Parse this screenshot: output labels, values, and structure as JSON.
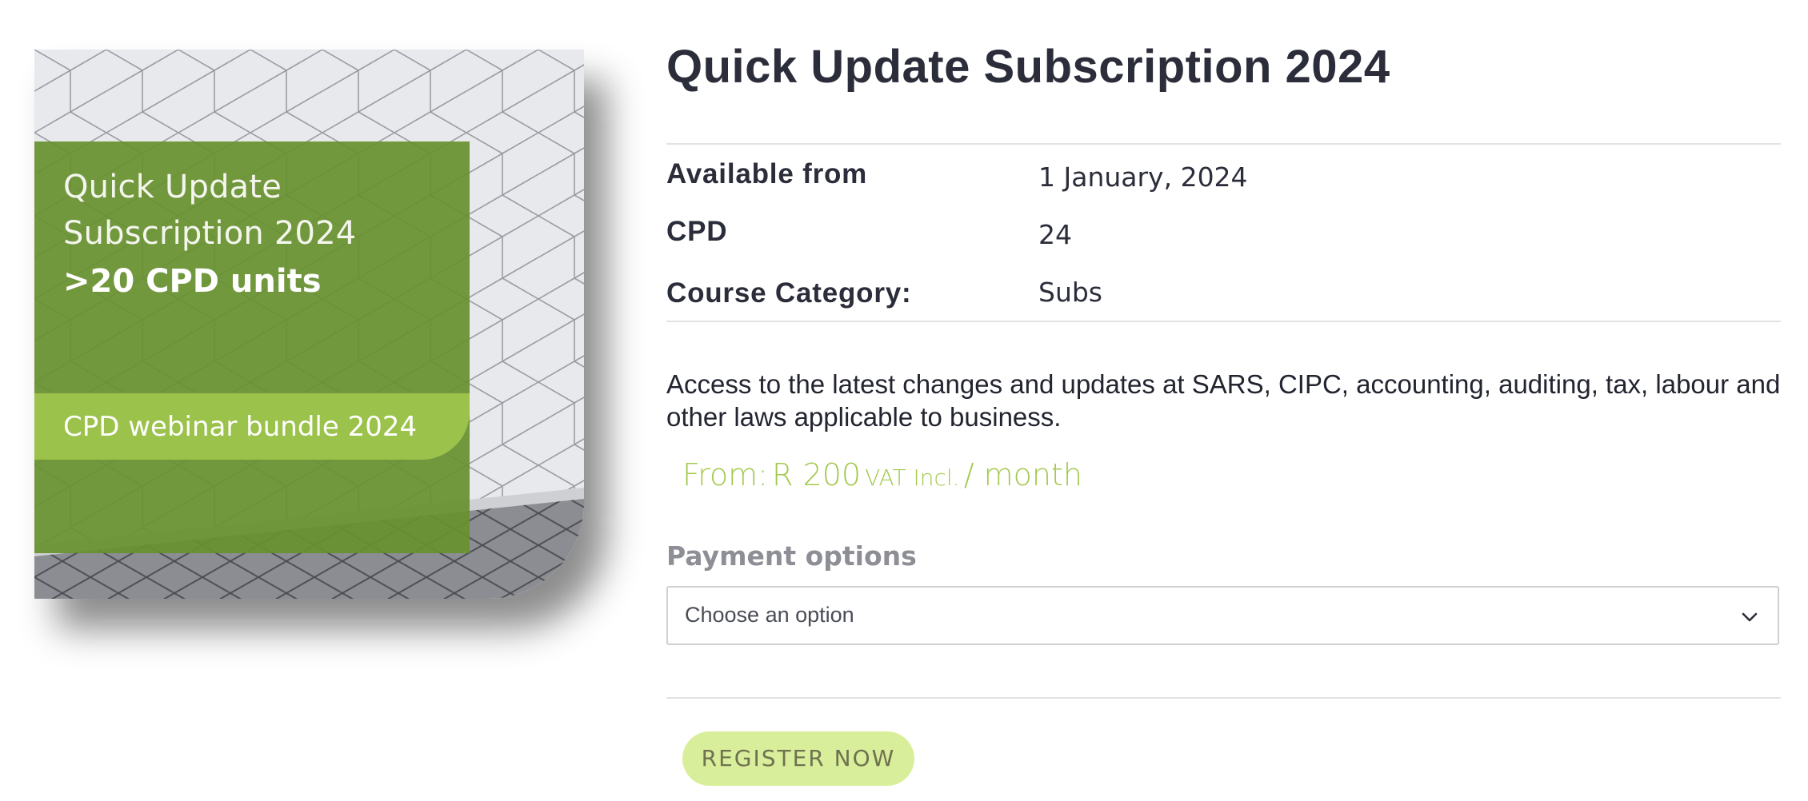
{
  "product_image": {
    "title_line1": "Quick Update",
    "title_line2": "Subscription 2024",
    "title_bold": ">20 CPD units",
    "band_text": "CPD webinar bundle 2024",
    "colors": {
      "green_panel": "#689130",
      "lime_band": "#9bc24a"
    }
  },
  "product": {
    "title": "Quick Update Subscription 2024",
    "meta": [
      {
        "label": "Available from",
        "value": "1 January, 2024"
      },
      {
        "label": "CPD",
        "value": "24"
      },
      {
        "label": "Course Category:",
        "value": "Subs"
      }
    ],
    "description": "Access to the latest changes and updates at SARS, CIPC, accounting, auditing, tax, labour and other laws applicable to business.",
    "price": {
      "from": "From:",
      "amount": "R 200",
      "vat": "VAT Incl.",
      "period": "/ month",
      "color": "#a3c94e"
    },
    "payment": {
      "label": "Payment options",
      "selected": "Choose an option",
      "icon": "chevron-down-icon"
    },
    "register_label": "REGISTER NOW"
  }
}
